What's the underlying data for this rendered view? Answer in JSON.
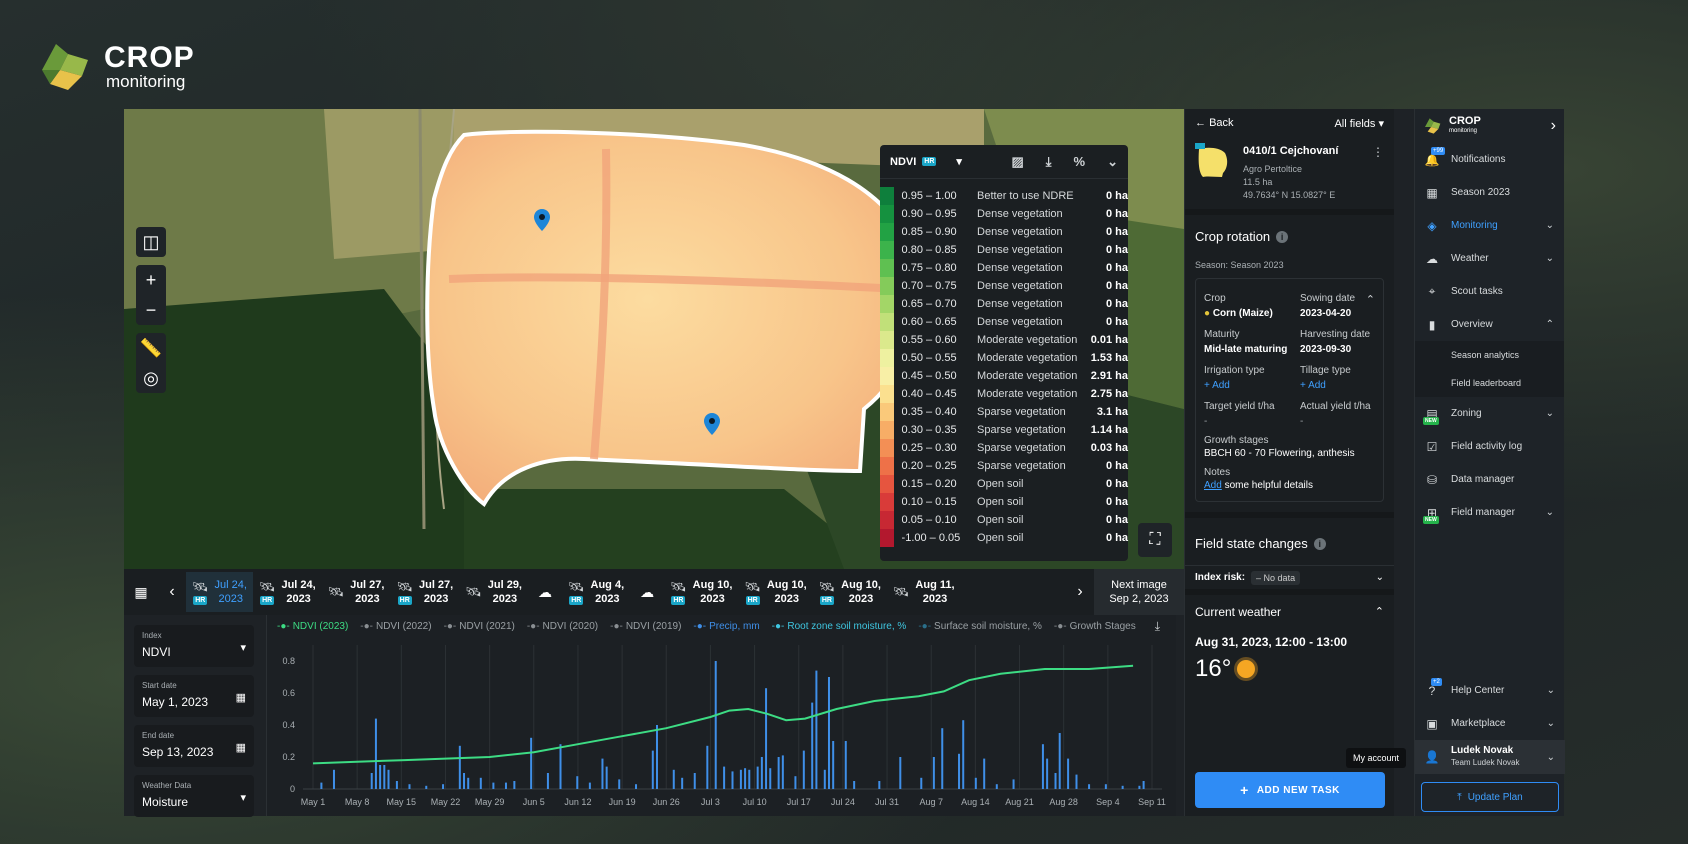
{
  "brand": {
    "title": "CROP",
    "subtitle": "monitoring"
  },
  "map": {
    "zoom_in": "+",
    "zoom_out": "−",
    "legend": {
      "index": "NDVI",
      "badge": "HR",
      "rows": [
        {
          "range": "0.95 – 1.00",
          "label": "Better to use NDRE",
          "area": "0 ha",
          "color": "#0e7f3c"
        },
        {
          "range": "0.90 – 0.95",
          "label": "Dense vegetation",
          "area": "0 ha",
          "color": "#15913f"
        },
        {
          "range": "0.85 – 0.90",
          "label": "Dense vegetation",
          "area": "0 ha",
          "color": "#22a244"
        },
        {
          "range": "0.80 – 0.85",
          "label": "Dense vegetation",
          "area": "0 ha",
          "color": "#3cb34b"
        },
        {
          "range": "0.75 – 0.80",
          "label": "Dense vegetation",
          "area": "0 ha",
          "color": "#5fc051"
        },
        {
          "range": "0.70 – 0.75",
          "label": "Dense vegetation",
          "area": "0 ha",
          "color": "#84cb5a"
        },
        {
          "range": "0.65 – 0.70",
          "label": "Dense vegetation",
          "area": "0 ha",
          "color": "#a3d667"
        },
        {
          "range": "0.60 – 0.65",
          "label": "Dense vegetation",
          "area": "0 ha",
          "color": "#c1e079"
        },
        {
          "range": "0.55 – 0.60",
          "label": "Moderate vegetation",
          "area": "0.01 ha",
          "color": "#dbe98c"
        },
        {
          "range": "0.50 – 0.55",
          "label": "Moderate vegetation",
          "area": "1.53 ha",
          "color": "#eef1a0"
        },
        {
          "range": "0.45 – 0.50",
          "label": "Moderate vegetation",
          "area": "2.91 ha",
          "color": "#f8efa6"
        },
        {
          "range": "0.40 – 0.45",
          "label": "Moderate vegetation",
          "area": "2.75 ha",
          "color": "#fbe08f"
        },
        {
          "range": "0.35 – 0.40",
          "label": "Sparse vegetation",
          "area": "3.1 ha",
          "color": "#fac97a"
        },
        {
          "range": "0.30 – 0.35",
          "label": "Sparse vegetation",
          "area": "1.14 ha",
          "color": "#f7ad66"
        },
        {
          "range": "0.25 – 0.30",
          "label": "Sparse vegetation",
          "area": "0.03 ha",
          "color": "#f38f55"
        },
        {
          "range": "0.20 – 0.25",
          "label": "Sparse vegetation",
          "area": "0 ha",
          "color": "#ee7148"
        },
        {
          "range": "0.15 – 0.20",
          "label": "Open soil",
          "area": "0 ha",
          "color": "#e6553f"
        },
        {
          "range": "0.10 – 0.15",
          "label": "Open soil",
          "area": "0 ha",
          "color": "#d93b39"
        },
        {
          "range": "0.05 – 0.10",
          "label": "Open soil",
          "area": "0 ha",
          "color": "#c72833"
        },
        {
          "range": "-1.00 – 0.05",
          "label": "Open soil",
          "area": "0 ha",
          "color": "#b3182e"
        }
      ]
    }
  },
  "timeline": {
    "items": [
      {
        "line1": "Jul 24,",
        "line2": "2023",
        "hr": true,
        "active": true
      },
      {
        "line1": "Jul 24,",
        "line2": "2023",
        "hr": true,
        "active": false
      },
      {
        "line1": "Jul 27,",
        "line2": "2023",
        "hr": false,
        "active": false
      },
      {
        "line1": "Jul 27,",
        "line2": "2023",
        "hr": true,
        "active": false
      },
      {
        "line1": "Jul 29,",
        "line2": "2023",
        "hr": false,
        "active": false
      },
      {
        "line1": "Aug 4,",
        "line2": "2023",
        "hr": true,
        "active": false,
        "cloud_before": true
      },
      {
        "line1": "Aug 10,",
        "line2": "2023",
        "hr": true,
        "active": false,
        "cloud_before": true
      },
      {
        "line1": "Aug 10,",
        "line2": "2023",
        "hr": true,
        "active": false
      },
      {
        "line1": "Aug 10,",
        "line2": "2023",
        "hr": true,
        "active": false
      },
      {
        "line1": "Aug 11,",
        "line2": "2023",
        "hr": false,
        "active": false
      }
    ],
    "next_line1": "Next image",
    "next_line2": "Sep 2, 2023",
    "hr_badge": "HR"
  },
  "filters": {
    "index_label": "Index",
    "index_value": "NDVI",
    "start_label": "Start date",
    "start_value": "May 1, 2023",
    "end_label": "End date",
    "end_value": "Sep 13, 2023",
    "weather_label": "Weather Data",
    "weather_value": "Moisture"
  },
  "chart_data": {
    "type": "line",
    "legend": [
      {
        "name": "NDVI (2023)",
        "color": "#3ddc84",
        "active": true
      },
      {
        "name": "NDVI (2022)",
        "color": "#8a8f93",
        "active": false
      },
      {
        "name": "NDVI (2021)",
        "color": "#8a8f93",
        "active": false
      },
      {
        "name": "NDVI (2020)",
        "color": "#8a8f93",
        "active": false
      },
      {
        "name": "NDVI (2019)",
        "color": "#8a8f93",
        "active": false
      },
      {
        "name": "Precip, mm",
        "color": "#3f8fe8",
        "active": true
      },
      {
        "name": "Root zone soil moisture, %",
        "color": "#3fc6e0",
        "active": true
      },
      {
        "name": "Surface soil moisture, %",
        "color": "#2a6f8a",
        "active": false
      },
      {
        "name": "Growth Stages",
        "color": "#8a8f93",
        "active": false
      }
    ],
    "ylim": [
      0,
      0.9
    ],
    "yticks": [
      "0",
      "0.2",
      "0.4",
      "0.6",
      "0.8"
    ],
    "xticks": [
      "May 1",
      "May 8",
      "May 15",
      "May 22",
      "May 29",
      "Jun 5",
      "Jun 12",
      "Jun 19",
      "Jun 26",
      "Jul 3",
      "Jul 10",
      "Jul 17",
      "Jul 24",
      "Jul 31",
      "Aug 7",
      "Aug 14",
      "Aug 21",
      "Aug 28",
      "Sep 4",
      "Sep 11"
    ],
    "days_total": 136,
    "ndvi": [
      [
        1,
        0.16
      ],
      [
        8,
        0.17
      ],
      [
        15,
        0.18
      ],
      [
        22,
        0.19
      ],
      [
        29,
        0.2
      ],
      [
        36,
        0.23
      ],
      [
        43,
        0.28
      ],
      [
        50,
        0.33
      ],
      [
        57,
        0.38
      ],
      [
        64,
        0.45
      ],
      [
        67,
        0.49
      ],
      [
        70,
        0.5
      ],
      [
        73,
        0.47
      ],
      [
        76,
        0.43
      ],
      [
        79,
        0.44
      ],
      [
        84,
        0.5
      ],
      [
        90,
        0.55
      ],
      [
        97,
        0.58
      ],
      [
        101,
        0.61
      ],
      [
        105,
        0.68
      ],
      [
        110,
        0.72
      ],
      [
        117,
        0.75
      ],
      [
        124,
        0.75
      ],
      [
        131,
        0.77
      ]
    ],
    "precip": [
      [
        3,
        0.04
      ],
      [
        6,
        0.12
      ],
      [
        15,
        0.1
      ],
      [
        16,
        0.44
      ],
      [
        17,
        0.15
      ],
      [
        18,
        0.15
      ],
      [
        19,
        0.12
      ],
      [
        21,
        0.05
      ],
      [
        24,
        0.03
      ],
      [
        28,
        0.02
      ],
      [
        32,
        0.03
      ],
      [
        36,
        0.27
      ],
      [
        37,
        0.1
      ],
      [
        38,
        0.07
      ],
      [
        41,
        0.07
      ],
      [
        44,
        0.04
      ],
      [
        47,
        0.04
      ],
      [
        49,
        0.05
      ],
      [
        53,
        0.32
      ],
      [
        57,
        0.1
      ],
      [
        60,
        0.28
      ],
      [
        64,
        0.08
      ],
      [
        67,
        0.04
      ],
      [
        70,
        0.19
      ],
      [
        71,
        0.14
      ],
      [
        74,
        0.06
      ],
      [
        78,
        0.03
      ],
      [
        82,
        0.24
      ],
      [
        83,
        0.4
      ],
      [
        87,
        0.12
      ],
      [
        89,
        0.07
      ],
      [
        92,
        0.1
      ],
      [
        95,
        0.27
      ],
      [
        97,
        0.8
      ],
      [
        99,
        0.14
      ],
      [
        101,
        0.11
      ],
      [
        103,
        0.12
      ],
      [
        104,
        0.13
      ],
      [
        105,
        0.12
      ],
      [
        107,
        0.14
      ],
      [
        108,
        0.2
      ],
      [
        109,
        0.63
      ],
      [
        110,
        0.13
      ],
      [
        112,
        0.2
      ],
      [
        113,
        0.21
      ],
      [
        116,
        0.08
      ],
      [
        118,
        0.24
      ],
      [
        120,
        0.54
      ],
      [
        121,
        0.74
      ],
      [
        123,
        0.12
      ],
      [
        124,
        0.7
      ],
      [
        125,
        0.3
      ],
      [
        128,
        0.3
      ],
      [
        130,
        0.05
      ],
      [
        136,
        0.05
      ],
      [
        141,
        0.2
      ],
      [
        146,
        0.07
      ],
      [
        149,
        0.2
      ],
      [
        151,
        0.38
      ],
      [
        155,
        0.22
      ],
      [
        156,
        0.43
      ],
      [
        159,
        0.07
      ],
      [
        161,
        0.19
      ],
      [
        164,
        0.03
      ],
      [
        168,
        0.06
      ],
      [
        175,
        0.28
      ],
      [
        176,
        0.19
      ],
      [
        178,
        0.1
      ],
      [
        179,
        0.35
      ],
      [
        181,
        0.19
      ],
      [
        183,
        0.09
      ],
      [
        186,
        0.03
      ],
      [
        190,
        0.03
      ],
      [
        194,
        0.02
      ],
      [
        198,
        0.02
      ],
      [
        199,
        0.05
      ]
    ]
  },
  "field": {
    "back": "Back",
    "all_fields": "All fields",
    "name": "0410/1 Cejchovaní",
    "company": "Agro Pertoltice",
    "area": "11.5 ha",
    "coords": "49.7634° N 15.0827° E",
    "hr_badge": "HR",
    "crop_rotation": "Crop rotation",
    "season": "Season: Season 2023",
    "crop_k": "Crop",
    "crop_v": "Corn (Maize)",
    "sowing_k": "Sowing date",
    "sowing_v": "2023-04-20",
    "maturity_k": "Maturity",
    "maturity_v": "Mid-late maturing",
    "harvest_k": "Harvesting date",
    "harvest_v": "2023-09-30",
    "irrigation_k": "Irrigation type",
    "irrigation_v": "+ Add",
    "tillage_k": "Tillage type",
    "tillage_v": "+ Add",
    "target_k": "Target yield t/ha",
    "target_v": "-",
    "actual_k": "Actual yield t/ha",
    "actual_v": "-",
    "growth_k": "Growth stages",
    "growth_v": "BBCH 60 - 70 Flowering, anthesis",
    "notes_k": "Notes",
    "notes_link": "Add",
    "notes_rest": " some helpful details",
    "state_changes": "Field state changes",
    "index_risk": "Index risk:",
    "no_data": "No data",
    "weather_title": "Current weather",
    "weather_date": "Aug 31, 2023, 12:00 - 13:00",
    "weather_temp": "16°",
    "add_task": "ADD NEW TASK",
    "tooltip": "My account"
  },
  "nav": {
    "brand": "CROP",
    "brand_sub": "monitoring",
    "items": [
      {
        "key": "notifications",
        "label": "Notifications",
        "badge": "+99"
      },
      {
        "key": "season",
        "label": "Season 2023"
      },
      {
        "key": "monitoring",
        "label": "Monitoring",
        "active": true,
        "chevron": "down"
      },
      {
        "key": "weather",
        "label": "Weather",
        "chevron": "down"
      },
      {
        "key": "scout",
        "label": "Scout tasks"
      },
      {
        "key": "overview",
        "label": "Overview",
        "chevron": "up"
      }
    ],
    "sub": [
      "Season analytics",
      "Field leaderboard"
    ],
    "items2": [
      {
        "key": "zoning",
        "label": "Zoning",
        "chevron": "down",
        "new": "NEW"
      },
      {
        "key": "activity",
        "label": "Field activity log"
      },
      {
        "key": "data",
        "label": "Data manager"
      },
      {
        "key": "fieldmgr",
        "label": "Field manager",
        "chevron": "down",
        "new": "NEW"
      }
    ],
    "help": "Help Center",
    "help_badge": "+2",
    "marketplace": "Marketplace",
    "user_name": "Ludek Novak",
    "user_team": "Team Ludek Novak",
    "update_plan": "Update Plan"
  }
}
